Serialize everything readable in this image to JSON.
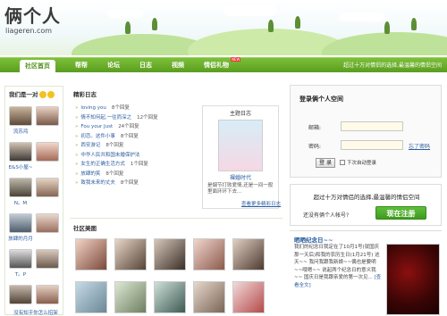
{
  "header": {
    "logo_text": "俩个人",
    "logo_domain": "liageren.com"
  },
  "nav": {
    "items": [
      {
        "label": "社区首页",
        "active": true
      },
      {
        "label": "帮帮"
      },
      {
        "label": "论坛"
      },
      {
        "label": "日志"
      },
      {
        "label": "视频"
      },
      {
        "label": "情侣礼物",
        "badge": "NEW"
      }
    ],
    "slogan": "超过十万对情侣的选择,最温馨的情侣空间"
  },
  "couples": {
    "title": "我们是一对",
    "items": [
      {
        "name": "流苏鸿"
      },
      {
        "name": "E&S小屋~"
      },
      {
        "name": "N。M"
      },
      {
        "name": "放肆的月月"
      },
      {
        "name": "T。P"
      },
      {
        "name": "没有知乎你怎么招架"
      }
    ]
  },
  "diary": {
    "title": "精彩日志",
    "rows": [
      {
        "title": "loving you",
        "count": "8个回复"
      },
      {
        "title": "情不知何起,一往而深之",
        "count": "12个回复"
      },
      {
        "title": "Fou your Just",
        "count": "24个回复"
      },
      {
        "title": "初恋。这件小事",
        "count": "8个回复"
      },
      {
        "title": "西安游记",
        "count": "8个回复"
      },
      {
        "title": "中华人民共和国未婚保护法",
        "count": ""
      },
      {
        "title": "女生的正确生活方式",
        "count": "1个回复"
      },
      {
        "title": "放肆的笑",
        "count": "8个回复"
      },
      {
        "title": "致我未来的丈夫",
        "count": "8个回复"
      }
    ],
    "feature": {
      "header": "主题日志",
      "name": "裸婚时代",
      "desc": "是烟节打败爱情,还是一间一般里面环环下去..."
    },
    "more": "查看更多精彩日志"
  },
  "photos": {
    "title": "社区美图"
  },
  "login": {
    "title": "登录俩个人空间",
    "email_label": "邮箱:",
    "password_label": "密码:",
    "forgot": "忘了密码",
    "button": "登 录",
    "remember": "下次自动登录"
  },
  "register": {
    "title": "超过十万对情侣的选择,最温馨的情侣空间",
    "question": "还没有俩个人帐号?",
    "button": "现在注册"
  },
  "news": {
    "title": "晒晒纪念日~~",
    "text": "我们的纪念日我定在了10月1号(就国庆那一天后)和我的农历生日(1月21号) 这天~~ 我问我跟我新娘~~偶也是要明~~哦嗯~~ 说起两个纪念日的意义我~~ 国庆日是我跟亲爱的第一次见...",
    "more": "[查看全文]"
  }
}
